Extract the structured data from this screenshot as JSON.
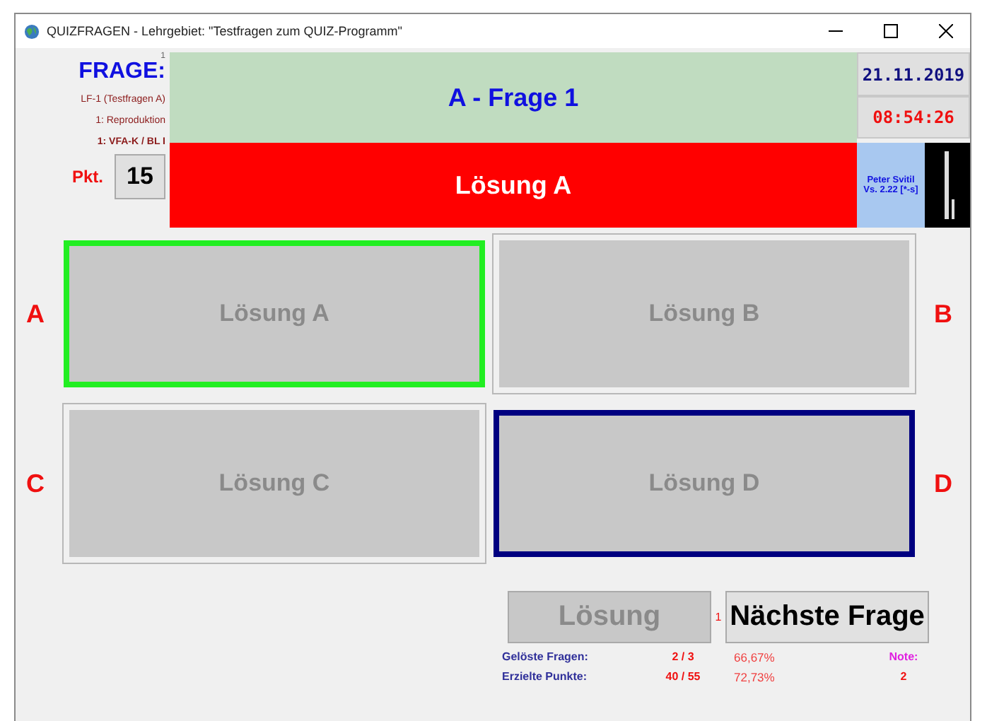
{
  "window": {
    "title": "QUIZFRAGEN - Lehrgebiet: \"Testfragen zum QUIZ-Programm\""
  },
  "question_info": {
    "index": "1",
    "heading": "FRAGE:",
    "set": "LF-1  (Testfragen A)",
    "level": "1: Reproduktion",
    "category": "1: VFA-K / BL I",
    "points_label": "Pkt.",
    "points": "15"
  },
  "question": "A - Frage 1",
  "solution": "Lösung A",
  "date": "21.11.2019",
  "time": "08:54:26",
  "author": {
    "name": "Peter Svitil",
    "version": "Vs. 2.22 [*-s]"
  },
  "answers": [
    {
      "letter": "A",
      "text": "Lösung A",
      "correct": true,
      "selected": false
    },
    {
      "letter": "B",
      "text": "Lösung B",
      "correct": false,
      "selected": false
    },
    {
      "letter": "C",
      "text": "Lösung C",
      "correct": false,
      "selected": false
    },
    {
      "letter": "D",
      "text": "Lösung D",
      "correct": false,
      "selected": true
    }
  ],
  "solution_button": {
    "label": "Lösung",
    "disabled": true
  },
  "counter": "1",
  "next_button": {
    "label": "Nächste Frage",
    "disabled": false
  },
  "stats": [
    {
      "label": "Gelöste Fragen:",
      "value": "2 / 3",
      "percent": "66,67%"
    },
    {
      "label": "Erzielte Punkte:",
      "value": "40 / 55",
      "percent": "72,73%"
    }
  ],
  "grade": {
    "label": "Note:",
    "value": "2"
  }
}
